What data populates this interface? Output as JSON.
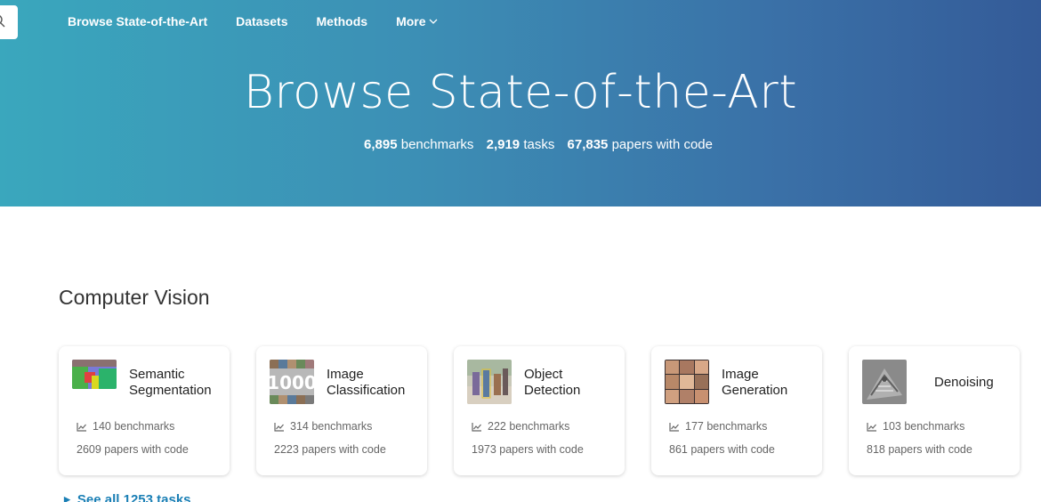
{
  "nav": {
    "items": [
      "Browse State-of-the-Art",
      "Datasets",
      "Methods",
      "More"
    ]
  },
  "hero": {
    "title": "Browse State-of-the-Art",
    "stats": [
      {
        "num": "6,895",
        "label": "benchmarks"
      },
      {
        "num": "2,919",
        "label": "tasks"
      },
      {
        "num": "67,835",
        "label": "papers with code"
      }
    ]
  },
  "section": {
    "title": "Computer Vision",
    "see_all": "See all 1253 tasks"
  },
  "cards": [
    {
      "title": "Semantic Segmentation",
      "benchmarks": "140 benchmarks",
      "papers": "2609 papers with code"
    },
    {
      "title": "Image Classification",
      "benchmarks": "314 benchmarks",
      "papers": "2223 papers with code"
    },
    {
      "title": "Object Detection",
      "benchmarks": "222 benchmarks",
      "papers": "1973 papers with code"
    },
    {
      "title": "Image Generation",
      "benchmarks": "177 benchmarks",
      "papers": "861 papers with code"
    },
    {
      "title": "Denoising",
      "benchmarks": "103 benchmarks",
      "papers": "818 papers with code"
    }
  ],
  "colors": {
    "hero_start": "#3aa7bd",
    "hero_end": "#345b98",
    "link": "#1a7fb5"
  }
}
